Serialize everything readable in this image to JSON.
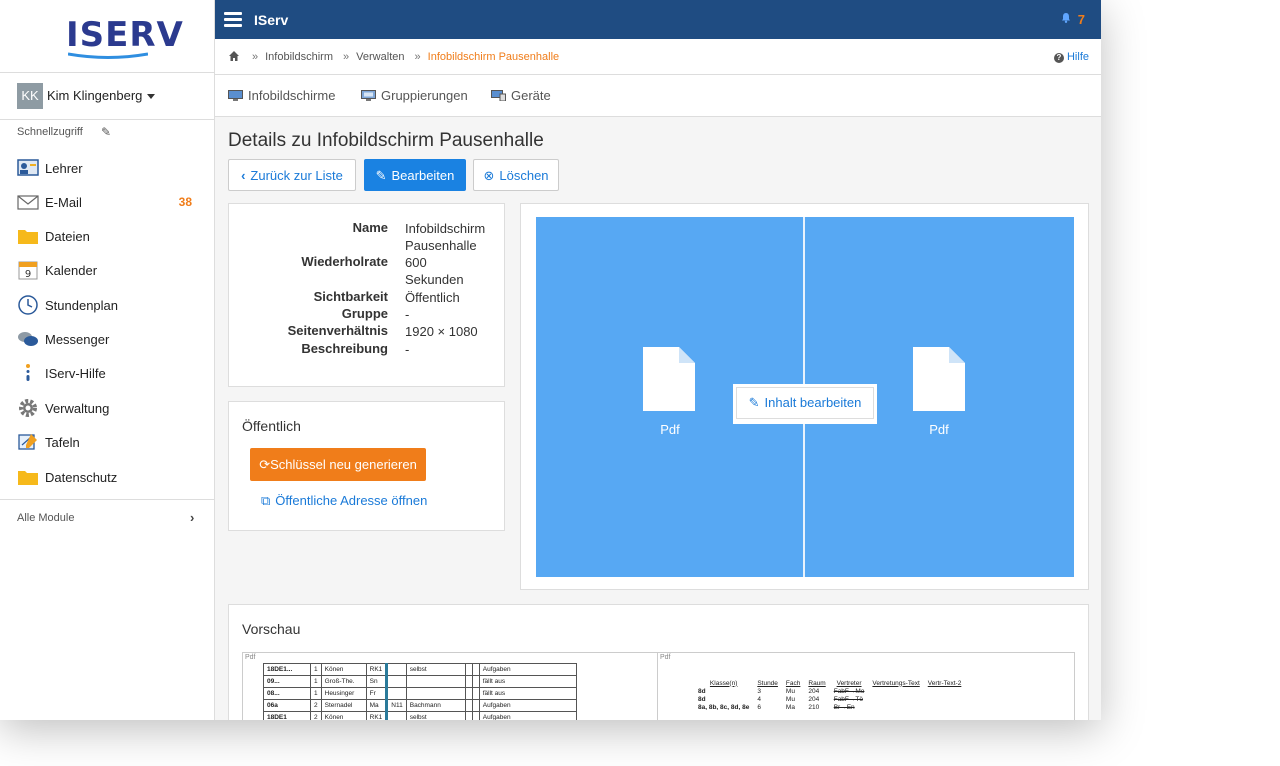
{
  "brand": {
    "logo_text": "ISERV",
    "accent": "#1f4c82",
    "orange": "#f07d1a",
    "blue": "#1a82e2",
    "screen_blue": "#57a8f3"
  },
  "sidebar": {
    "user": {
      "initials": "KK",
      "name": "Kim Klingenberg"
    },
    "quick_access_label": "Schnellzugriff",
    "items": [
      {
        "label": "Lehrer",
        "icon": "teacher-icon",
        "badge": ""
      },
      {
        "label": "E-Mail",
        "icon": "mail-icon",
        "badge": "38"
      },
      {
        "label": "Dateien",
        "icon": "folder-icon",
        "badge": ""
      },
      {
        "label": "Kalender",
        "icon": "calendar-icon",
        "badge": ""
      },
      {
        "label": "Stundenplan",
        "icon": "clock-icon",
        "badge": ""
      },
      {
        "label": "Messenger",
        "icon": "chat-icon",
        "badge": ""
      },
      {
        "label": "IServ-Hilfe",
        "icon": "info-icon",
        "badge": ""
      },
      {
        "label": "Verwaltung",
        "icon": "gear-icon",
        "badge": ""
      },
      {
        "label": "Tafeln",
        "icon": "board-icon",
        "badge": ""
      },
      {
        "label": "Datenschutz",
        "icon": "folder-icon",
        "badge": ""
      }
    ],
    "all_modules_label": "Alle Module"
  },
  "topbar": {
    "title": "IServ",
    "notification_count": "7"
  },
  "breadcrumb": {
    "items": [
      "Infobildschirm",
      "Verwalten"
    ],
    "active": "Infobildschirm Pausenhalle",
    "help": "Hilfe"
  },
  "tabs": [
    {
      "label": "Infobildschirme"
    },
    {
      "label": "Gruppierungen"
    },
    {
      "label": "Geräte"
    }
  ],
  "page": {
    "title": "Details zu Infobildschirm Pausenhalle",
    "back_label": "Zurück zur Liste",
    "edit_label": "Bearbeiten",
    "delete_label": "Löschen"
  },
  "details": {
    "name_label": "Name",
    "name_value": "Infobildschirm Pausenhalle",
    "repeat_label": "Wiederholrate",
    "repeat_value": "600 Sekunden",
    "visibility_label": "Sichtbarkeit",
    "visibility_value": "Öffentlich",
    "group_label": "Gruppe",
    "group_value": "-",
    "aspect_label": "Seitenverhältnis",
    "aspect_value": "1920 × 1080",
    "description_label": "Beschreibung",
    "description_value": "-"
  },
  "public": {
    "title": "Öffentlich",
    "regen_label": "Schlüssel neu generieren",
    "open_label": "Öffentliche Adresse öffnen"
  },
  "layout_preview": {
    "left_label": "Pdf",
    "right_label": "Pdf",
    "edit_label": "Inhalt bearbeiten"
  },
  "vorschau": {
    "title": "Vorschau",
    "left_tag": "Pdf",
    "right_tag": "Pdf",
    "table1": [
      [
        "18DE1...",
        "1",
        "Könen",
        "RK1",
        "",
        "selbst",
        "",
        "",
        "Aufgaben"
      ],
      [
        "09...",
        "1",
        "Groß-The.",
        "Sn",
        "",
        "",
        "",
        "",
        "fällt aus"
      ],
      [
        "08...",
        "1",
        "Heusinger",
        "Fr",
        "",
        "",
        "",
        "",
        "fällt aus"
      ],
      [
        "06a",
        "2",
        "Sternadel",
        "Ma",
        "N11",
        "Bachmann",
        "",
        "",
        "Aufgaben"
      ],
      [
        "18DE1",
        "2",
        "Könen",
        "RK1",
        "",
        "selbst",
        "",
        "",
        "Aufgaben"
      ]
    ],
    "table2_headers": [
      "Klasse(n)",
      "Stunde",
      "Fach",
      "Raum",
      "Vertreter",
      "Vertretungs-Text",
      "Vertr-Text-2"
    ],
    "table2": [
      [
        "8d",
        "3",
        "Mu",
        "204",
        "FabF→Mo"
      ],
      [
        "8d",
        "4",
        "Mu",
        "204",
        "FabF→Tö"
      ],
      [
        "8a, 8b, 8c, 8d, 8e",
        "6",
        "Ma",
        "210",
        "Br→En"
      ]
    ]
  }
}
